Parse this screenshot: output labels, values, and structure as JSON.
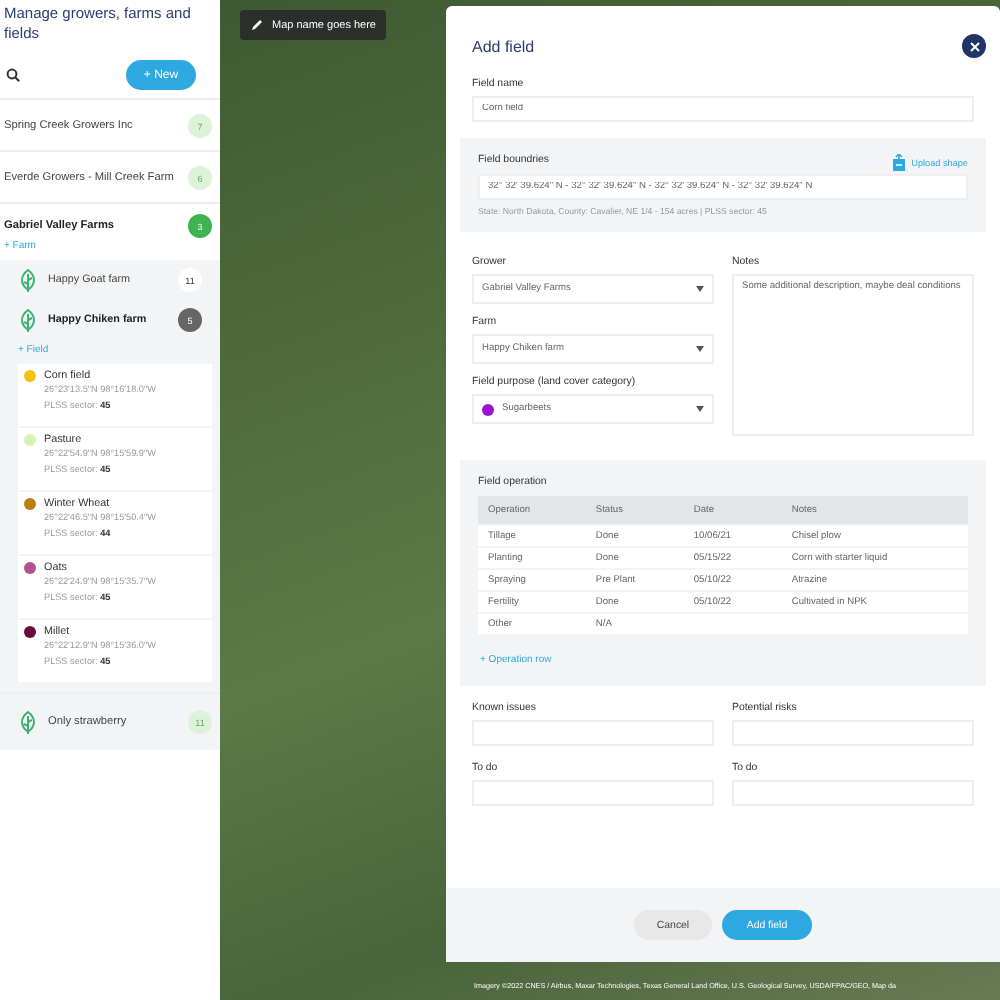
{
  "sidebar": {
    "title": "Manage growers, farms and fields",
    "new_button": "+ New",
    "growers": [
      {
        "name": "Spring Creek Growers Inc",
        "count": "7",
        "selected": false
      },
      {
        "name": "Everde Growers - Mill Creek Farm",
        "count": "6",
        "selected": false
      },
      {
        "name": "Gabriel Valley Farms",
        "count": "3",
        "selected": true,
        "add_link": "+ Farm",
        "farms": [
          {
            "name": "Happy Goat farm",
            "count": "11",
            "selected": false
          },
          {
            "name": "Happy Chiken farm",
            "count": "5",
            "selected": true,
            "add_link": "+ Field",
            "fields": [
              {
                "name": "Corn field",
                "coords": "26°23'13.5\"N 98°16'18.0\"W",
                "sector": "PLSS sector: **45**",
                "color": "#f2c412"
              },
              {
                "name": "Pasture",
                "coords": "26°22'54.9\"N 98°15'59.9\"W",
                "sector": "PLSS sector: **45**",
                "color": "#d6f2b0"
              },
              {
                "name": "Winter Wheat",
                "coords": "26°22'46.5\"N 98°15'50.4\"W",
                "sector": "PLSS sector: **44**",
                "color": "#b8800c"
              },
              {
                "name": "Oats",
                "coords": "26°22'24.9\"N 98°15'35.7\"W",
                "sector": "PLSS sector: **45**",
                "color": "#b0508c"
              },
              {
                "name": "Millet",
                "coords": "26°22'12.9\"N 98°15'36.0\"W",
                "sector": "PLSS sector: **45**",
                "color": "#6a0a3c"
              }
            ]
          }
        ]
      },
      {
        "name": "Only strawberry",
        "count": "11",
        "selected": false,
        "kind": "farm"
      }
    ]
  },
  "map": {
    "name": "Map name goes here",
    "attribution": "Imagery ©2022 CNES / Airbus, Maxar Technologies, Texas General Land Office, U.S. Geological Survey, USDA/FPAC/GEO, Map da"
  },
  "dialog": {
    "title": "Add field",
    "field_name": {
      "label": "Field name",
      "value": "Corn field"
    },
    "boundaries": {
      "label": "Field boundries",
      "upload": "Upload shape",
      "value": "32° 32' 39.624\" N - 32° 32' 39.624\" N - 32° 32' 39.624\" N - 32° 32' 39.624\" N",
      "hint": "State: North Dakota, County: Cavalier, NE 1/4 - 154 acres  |  PLSS sector: 45"
    },
    "grower": {
      "label": "Grower",
      "value": "Gabriel Valley Farms"
    },
    "farm": {
      "label": "Farm",
      "value": "Happy Chiken farm"
    },
    "purpose": {
      "label": "Field purpose (land cover category)",
      "value": "Sugarbeets",
      "color": "#9a10d0"
    },
    "notes": {
      "label": "Notes",
      "value": "Some additional description, maybe deal conditions"
    },
    "operations": {
      "title": "Field operation",
      "columns": [
        "Operation",
        "Status",
        "Date",
        "Notes"
      ],
      "rows": [
        [
          "Tillage",
          "Done",
          "10/06/21",
          "Chisel plow"
        ],
        [
          "Planting",
          "Done",
          "05/15/22",
          "Corn with starter liquid"
        ],
        [
          "Spraying",
          "Pre Plant",
          "05/10/22",
          "Atrazine"
        ],
        [
          "Fertility",
          "Done",
          "05/10/22",
          "Cultivated in NPK"
        ],
        [
          "Other",
          "N/A",
          "",
          ""
        ]
      ],
      "add_link": "+ Operation row"
    },
    "extra_fields": [
      {
        "label": "Known issues"
      },
      {
        "label": "Potential risks"
      },
      {
        "label": "To do"
      },
      {
        "label": "To do"
      }
    ],
    "buttons": [
      {
        "label": "Cancel",
        "kind": "secondary"
      },
      {
        "label": "Add field",
        "kind": "primary"
      }
    ]
  }
}
